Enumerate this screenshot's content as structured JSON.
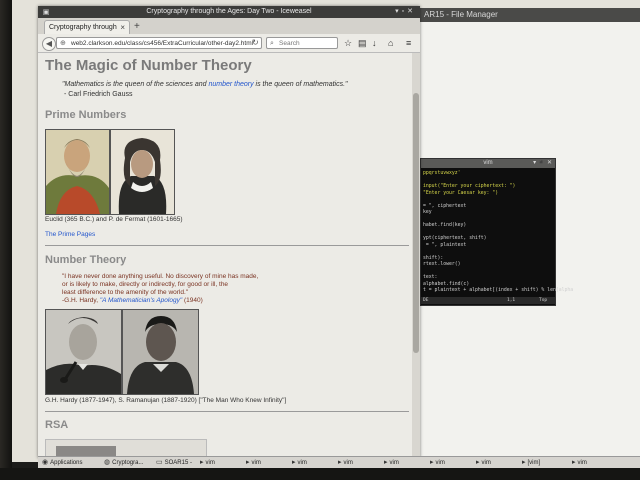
{
  "file_manager": {
    "title": "AR15 - File Manager"
  },
  "browser": {
    "window_title": "Cryptography through the Ages: Day Two - Iceweasel",
    "tab_label": "Cryptography through th...",
    "tab_close": "×",
    "new_tab": "+",
    "url": "web2.clarkson.edu/class/cs456/ExtraCurricular/other-day2.html",
    "search_placeholder": "Search"
  },
  "page": {
    "title": "The Magic of Number Theory",
    "quote1_part1": "\"Mathematics is the queen of the sciences and ",
    "quote1_link": "number theory",
    "quote1_part2": " is the queen of mathematics.\"",
    "quote1_attr": "- Carl Friedrich Gauss",
    "prime_heading": "Prime Numbers",
    "prime_caption": "Euclid (365 B.C.) and P. de Fermat (1601-1665)",
    "prime_link": "The Prime Pages",
    "nt_heading": "Number Theory",
    "hardy_q1": "\"I have never done anything useful. No discovery of mine has made,",
    "hardy_q2": "or is likely to make, directly or indirectly, for good or ill, the",
    "hardy_q3": "least difference to the amenity of the world.\"",
    "hardy_attr_pre": "-G.H. Hardy, ",
    "hardy_attr_link": "\"A Mathematician's Apology\"",
    "hardy_attr_post": " (1940)",
    "nt_caption": "G.H. Hardy (1877-1947), S. Ramanujan (1887-1920) [\"The Man Who Knew Infinity\"]",
    "rsa_heading": "RSA"
  },
  "vim": {
    "title": "vim",
    "lines": [
      {
        "text": "ppqrstuvwxyz'",
        "color": "#d7d74a"
      },
      {
        "text": "",
        "color": "#d0d0d0"
      },
      {
        "text": "input(\"Enter your ciphertext: \")",
        "color": "#d7d74a"
      },
      {
        "text": "\"Enter your Caesar key: \")",
        "color": "#d7d74a"
      },
      {
        "text": "",
        "color": "#d0d0d0"
      },
      {
        "text": "= \", ciphertext",
        "color": "#d0d0d0"
      },
      {
        "text": "key",
        "color": "#d0d0d0"
      },
      {
        "text": "",
        "color": "#d0d0d0"
      },
      {
        "text": "habet.find(key)",
        "color": "#d0d0d0"
      },
      {
        "text": "",
        "color": "#d0d0d0"
      },
      {
        "text": "ypt(ciphertext, shift)",
        "color": "#d0d0d0"
      },
      {
        "text": " = \", plaintext",
        "color": "#d0d0d0"
      },
      {
        "text": "",
        "color": "#d0d0d0"
      },
      {
        "text": "shift):",
        "color": "#d0d0d0"
      },
      {
        "text": "rtext.lower()",
        "color": "#d0d0d0"
      },
      {
        "text": "",
        "color": "#d0d0d0"
      },
      {
        "text": "text:",
        "color": "#d0d0d0"
      },
      {
        "text": "alphabet.find(c)",
        "color": "#d0d0d0"
      },
      {
        "text": "t = plaintext + alphabet[(index + shift) % len(alpha",
        "color": "#d0d0d0"
      }
    ],
    "status_left": "DE",
    "status_pos": "1,1",
    "status_right": "Top"
  },
  "taskbar": {
    "items": [
      {
        "label": "Applications",
        "icon": "applications-icon"
      },
      {
        "label": "Cryptogra...",
        "icon": "iceweasel-icon"
      },
      {
        "label": "SOAR15 -",
        "icon": "file-manager-icon"
      },
      {
        "label": "vim",
        "icon": "terminal-icon"
      },
      {
        "label": "vim",
        "icon": "terminal-icon"
      },
      {
        "label": "vim",
        "icon": "terminal-icon"
      },
      {
        "label": "vim",
        "icon": "terminal-icon"
      },
      {
        "label": "vim",
        "icon": "terminal-icon"
      },
      {
        "label": "vim",
        "icon": "terminal-icon"
      },
      {
        "label": "vim",
        "icon": "terminal-icon"
      },
      {
        "label": "[vim]",
        "icon": "terminal-icon"
      },
      {
        "label": "vim",
        "icon": "terminal-icon"
      }
    ]
  },
  "colors": {
    "link": "#2255cc",
    "heading": "#8a8a8a",
    "quote": "#7a3322",
    "vim_bg": "#0e0e0e"
  }
}
